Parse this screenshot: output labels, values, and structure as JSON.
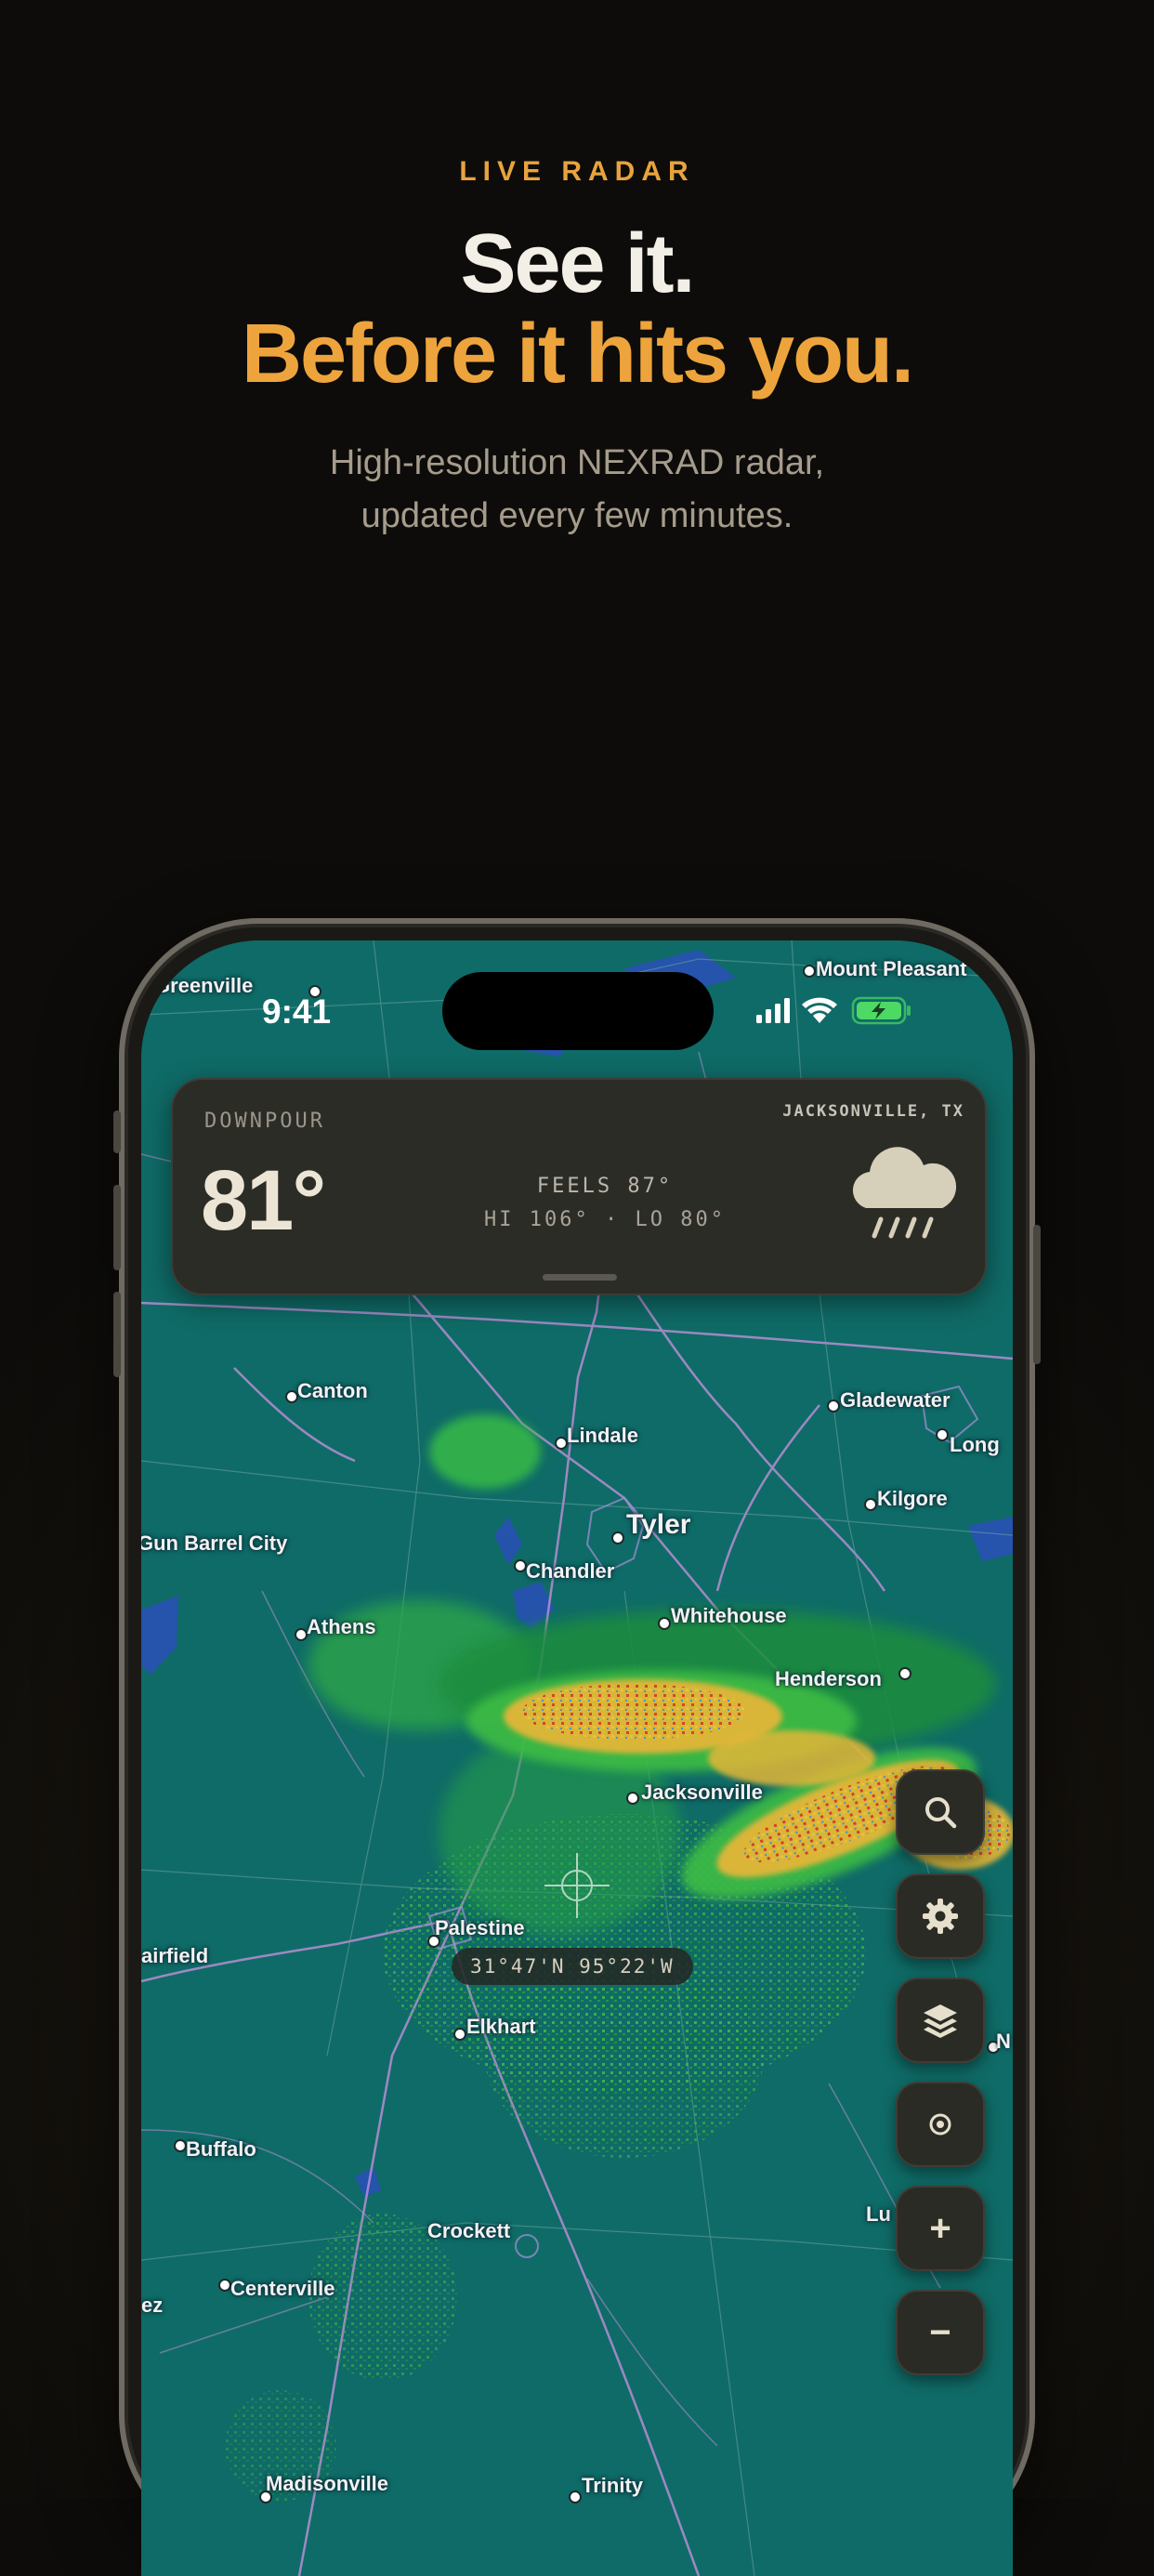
{
  "hero": {
    "eyebrow": "LIVE RADAR",
    "title_line1": "See it.",
    "title_line2": "Before it hits you.",
    "subtitle_line1": "High-resolution NEXRAD radar,",
    "subtitle_line2": "updated every few minutes."
  },
  "status_bar": {
    "time": "9:41"
  },
  "weather_card": {
    "condition": "DOWNPOUR",
    "location": "JACKSONVILLE, TX",
    "temperature": "81°",
    "feels_like": "FEELS 87°",
    "hi_lo": "HI 106° · LO 80°",
    "icon": "cloud-rain-icon"
  },
  "map": {
    "coordinate_readout": "31°47'N 95°22'W",
    "cities": [
      {
        "name": "Greenville"
      },
      {
        "name": "Mount Pleasant"
      },
      {
        "name": "Canton"
      },
      {
        "name": "Lindale"
      },
      {
        "name": "Gladewater"
      },
      {
        "name": "Long"
      },
      {
        "name": "Kilgore"
      },
      {
        "name": "Tyler"
      },
      {
        "name": "Gun Barrel City"
      },
      {
        "name": "Chandler"
      },
      {
        "name": "Athens"
      },
      {
        "name": "Whitehouse"
      },
      {
        "name": "Henderson"
      },
      {
        "name": "Jacksonville"
      },
      {
        "name": "Palestine"
      },
      {
        "name": "airfield"
      },
      {
        "name": "Elkhart"
      },
      {
        "name": "Buffalo"
      },
      {
        "name": "Crockett"
      },
      {
        "name": "Centerville"
      },
      {
        "name": "Lu"
      },
      {
        "name": "ez"
      },
      {
        "name": "Madisonville"
      },
      {
        "name": "Trinity"
      },
      {
        "name": "N"
      }
    ]
  },
  "controls": {
    "search_icon": "search-icon",
    "settings_icon": "gear-icon",
    "layers_icon": "layers-icon",
    "locate_icon": "target-icon",
    "zoom_in_label": "+",
    "zoom_out_label": "−"
  },
  "colors": {
    "accent": "#eea43c",
    "map_base": "#0e6a66",
    "card_bg": "#2c2c27"
  }
}
